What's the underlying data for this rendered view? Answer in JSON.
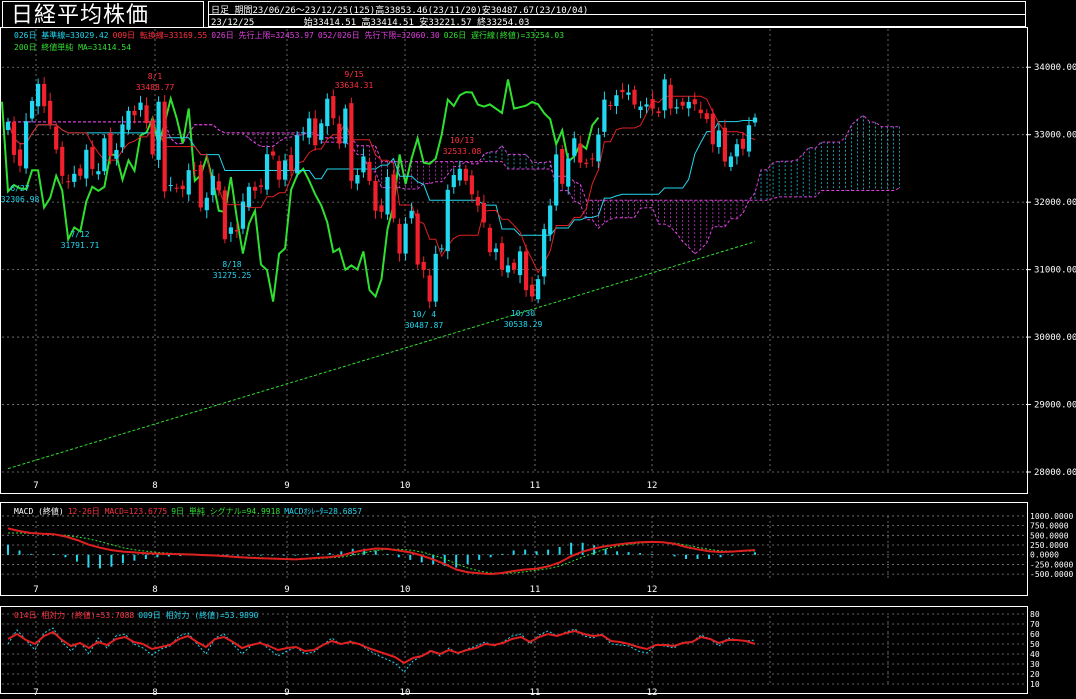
{
  "header": {
    "title": "日経平均株価",
    "mode": "日足",
    "period": "期間23/06/26～23/12/25(125)高33853.46(23/11/20)安30487.67(23/10/04)",
    "date": "23/12/25",
    "ohlc": "始33414.51 高33414.51 安33221.57 終33254.03"
  },
  "legend_main": {
    "kijun": "026日 基準線=33029.42",
    "tenkan": "009日 転換線=33169.55",
    "senkou_a": "026日 先行上限=32453.97",
    "senkou_b": "052/026日 先行下限=32060.30",
    "chikou": "026日 遅行線(終値)=33254.03",
    "ma200": "200日 終値単純 MA=31414.54"
  },
  "legend_macd": {
    "label": "MACD (終値)",
    "macd": "12-26日 MACD=123.6775",
    "signal": "9日 単純 シグナル=94.9918",
    "osc": "MACDｵｼﾚｰﾀ=28.6857"
  },
  "legend_rsi": {
    "rsi14": "014日 相対力 (終値)=53.7088",
    "rsi9": "009日 相対力 (終値)=53.9890"
  },
  "annotations": [
    {
      "date": "8/1",
      "value": "33488.77"
    },
    {
      "date": "9/15",
      "value": "33634.31"
    },
    {
      "date": "10/13",
      "value": "32533.08"
    },
    {
      "date": "6/27",
      "value": "32306.98"
    },
    {
      "date": "7/12",
      "value": "31791.71"
    },
    {
      "date": "8/18",
      "value": "31275.25"
    },
    {
      "date": "10/ 4",
      "value": "30487.87"
    },
    {
      "date": "10/30",
      "value": "30538.29"
    }
  ],
  "colors": {
    "up": "#22d8f0",
    "down": "#f0202c",
    "kijun": "#22d8f0",
    "tenkan": "#e02020",
    "chikou": "#30e030",
    "kumo": "#e040e0",
    "ma200": "#30e030",
    "grid": "#808080"
  },
  "chart_data": [
    {
      "type": "candlestick",
      "title": "日経平均株価",
      "y_ticks": [
        "34000.00",
        "33000.00",
        "32000.00",
        "31000.00",
        "30000.00",
        "29000.00",
        "28000.00"
      ],
      "x_ticks": [
        "7",
        "8",
        "9",
        "10",
        "11",
        "12"
      ],
      "ylim": [
        28000,
        34300
      ],
      "candles_close": [
        33190,
        32700,
        32540,
        33200,
        33500,
        33753,
        33422,
        33160,
        32780,
        32390,
        32300,
        32420,
        32391,
        32776,
        32493,
        32459,
        32946,
        32682,
        32773,
        33153,
        33354,
        33287,
        33476,
        33172,
        32707,
        33489,
        32159,
        32254,
        32204,
        32193,
        32474,
        32473,
        31921,
        32065,
        32390,
        32174,
        31450,
        31626,
        31566,
        32010,
        32227,
        32169,
        32226,
        32711,
        32691,
        32333,
        32619,
        32467,
        32991,
        33036,
        33242,
        32843,
        33168,
        33533,
        33243,
        32869,
        33388,
        32316,
        32402,
        32678,
        32315,
        31873,
        31857,
        32372,
        31758,
        31238,
        31681,
        31872,
        31075,
        30994,
        30526,
        31234,
        31314,
        32183,
        32402,
        32494,
        32316,
        32116,
        31950,
        31700,
        31259,
        31312,
        30999,
        31062,
        30999,
        31270,
        30696,
        30601,
        30859,
        31601,
        31950,
        32708,
        32271,
        32647,
        32947,
        32585,
        32568,
        32646,
        33002,
        33520,
        33425,
        33585,
        33631,
        33626,
        33446,
        33417,
        33449,
        33386,
        33321,
        33820,
        33388,
        33408,
        33431,
        33486,
        33451,
        33319,
        33231,
        32857,
        33063,
        32602,
        32678,
        32859,
        32791,
        33140,
        33254
      ],
      "ma200_start": 28050,
      "ma200_end": 31414.54
    },
    {
      "type": "line",
      "title": "MACD",
      "y_ticks": [
        "1000.0000",
        "750.0000",
        "500.0000",
        "250.0000",
        "0.0000",
        "-250.0000",
        "-500.0000"
      ],
      "ylim": [
        -600,
        1050
      ],
      "series": [
        {
          "name": "12-26日 MACD",
          "values": [
            680,
            610,
            560,
            540,
            530,
            470,
            380,
            260,
            180,
            120,
            80,
            60,
            40,
            30,
            20,
            10,
            5,
            -10,
            -20,
            -40,
            -60,
            -80,
            -90,
            -100,
            -110,
            -120,
            -100,
            -80,
            -60,
            -20,
            60,
            120,
            160,
            150,
            110,
            60,
            -20,
            -120,
            -240,
            -380,
            -450,
            -480,
            -500,
            -470,
            -420,
            -380,
            -360,
            -300,
            -200,
            -40,
            80,
            160,
            220,
            260,
            300,
            320,
            330,
            320,
            280,
            200,
            140,
            90,
            70,
            80,
            100,
            123
          ]
        },
        {
          "name": "9日 単純 シグナル",
          "values": [
            560,
            560,
            550,
            540,
            520,
            500,
            460,
            410,
            340,
            260,
            180,
            130,
            90,
            60,
            40,
            25,
            15,
            0,
            -10,
            -30,
            -50,
            -70,
            -80,
            -90,
            -100,
            -110,
            -110,
            -100,
            -80,
            -60,
            -10,
            50,
            110,
            140,
            140,
            120,
            70,
            -10,
            -110,
            -230,
            -340,
            -420,
            -470,
            -480,
            -470,
            -440,
            -400,
            -360,
            -290,
            -180,
            -60,
            50,
            150,
            220,
            270,
            300,
            320,
            320,
            300,
            250,
            190,
            140,
            100,
            90,
            92,
            95
          ]
        }
      ]
    },
    {
      "type": "line",
      "title": "RSI",
      "y_ticks": [
        "80",
        "70",
        "60",
        "50",
        "40",
        "30",
        "20",
        "10"
      ],
      "ylim": [
        10,
        80
      ],
      "series": [
        {
          "name": "014日 相対力",
          "values": [
            55,
            60,
            54,
            50,
            58,
            62,
            54,
            48,
            51,
            46,
            52,
            49,
            55,
            57,
            52,
            50,
            45,
            47,
            49,
            55,
            58,
            52,
            47,
            55,
            57,
            52,
            46,
            49,
            51,
            48,
            44,
            46,
            47,
            43,
            44,
            49,
            53,
            50,
            52,
            50,
            46,
            43,
            40,
            37,
            31,
            36,
            38,
            43,
            40,
            44,
            41,
            44,
            46,
            50,
            49,
            51,
            55,
            57,
            52,
            57,
            60,
            58,
            61,
            63,
            60,
            58,
            59,
            53,
            52,
            50,
            47,
            45,
            49,
            49,
            48,
            51,
            52,
            57,
            55,
            51,
            54,
            54,
            53,
            50
          ]
        },
        {
          "name": "009日 相対力",
          "values": [
            50,
            64,
            54,
            44,
            61,
            66,
            52,
            43,
            52,
            40,
            56,
            46,
            58,
            60,
            50,
            46,
            39,
            45,
            48,
            58,
            61,
            50,
            40,
            56,
            60,
            50,
            40,
            48,
            52,
            45,
            38,
            43,
            47,
            40,
            42,
            49,
            56,
            49,
            53,
            50,
            44,
            39,
            35,
            31,
            22,
            33,
            38,
            44,
            38,
            46,
            40,
            45,
            48,
            52,
            48,
            52,
            58,
            60,
            50,
            59,
            63,
            58,
            62,
            65,
            58,
            56,
            60,
            50,
            49,
            48,
            43,
            41,
            49,
            48,
            46,
            52,
            52,
            59,
            55,
            48,
            56,
            54,
            53,
            54
          ]
        }
      ]
    }
  ]
}
